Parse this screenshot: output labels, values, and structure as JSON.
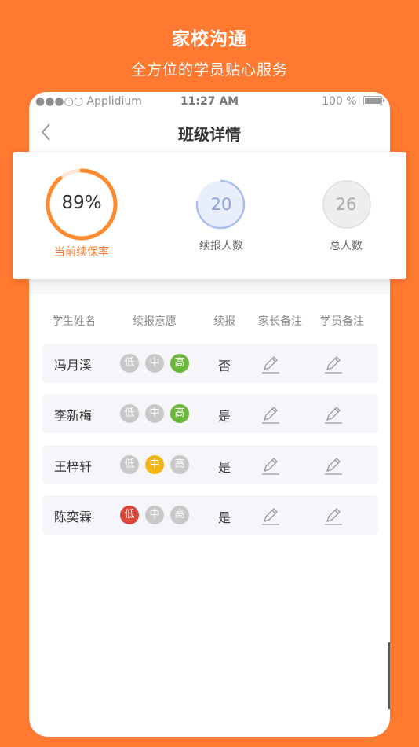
{
  "promo": {
    "title": "家校沟通",
    "subtitle": "全方位的学员贴心服务"
  },
  "status_bar": {
    "carrier": "●●●○○ Applidium",
    "time": "11:27 AM",
    "battery": "100 %"
  },
  "nav": {
    "title": "班级详情"
  },
  "stats": {
    "rate": {
      "value": "89%",
      "label": "当前续保率",
      "fraction": 0.89
    },
    "renewed": {
      "value": "20",
      "label": "续报人数",
      "fraction": 0.77
    },
    "total": {
      "value": "26",
      "label": "总人数"
    }
  },
  "table": {
    "headers": [
      "学生姓名",
      "续报意愿",
      "续报",
      "家长备注",
      "学员备注"
    ],
    "levels": [
      "低",
      "中",
      "高"
    ],
    "rows": [
      {
        "name": "冯月溪",
        "intent": "高",
        "renew": "否"
      },
      {
        "name": "李新梅",
        "intent": "高",
        "renew": "是"
      },
      {
        "name": "王梓轩",
        "intent": "中",
        "renew": "是"
      },
      {
        "name": "陈奕霖",
        "intent": "低",
        "renew": "是"
      }
    ]
  },
  "colors": {
    "brand_orange": "#FF7A30",
    "low_active": "#D9473B",
    "mid_active": "#F3B515",
    "high_active": "#6BB73B",
    "inactive": "#C8C8C8",
    "renew_ring": "#A9BEF0"
  }
}
